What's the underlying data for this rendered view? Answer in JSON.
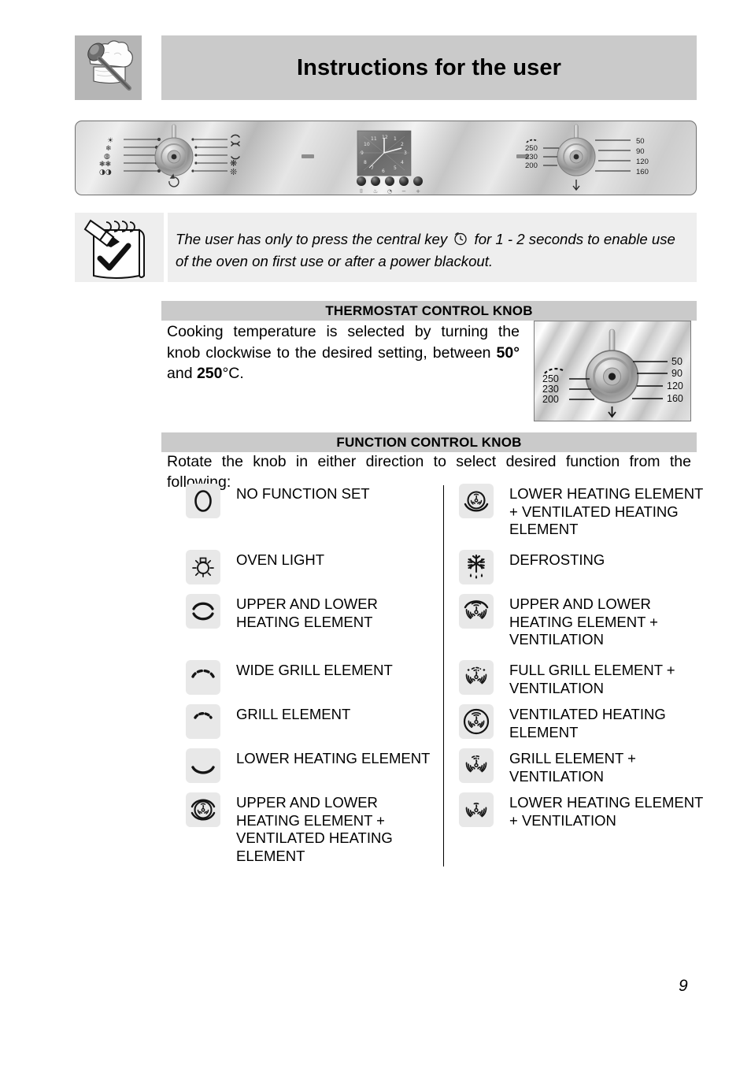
{
  "header": {
    "title": "Instructions for the user",
    "badge_icon": "chef-hat-spoon-icon"
  },
  "control_panel": {
    "function_knob_icon": "function-control-knob",
    "clock_display_icon": "analog-clock-display",
    "thermostat_knob_icon": "thermostat-control-knob",
    "thermostat_left_marks": [
      "250",
      "230",
      "200"
    ],
    "thermostat_right_marks": [
      "50",
      "90",
      "120",
      "160"
    ],
    "clock_buttons": [
      "lock-button",
      "pot-timer-button",
      "clock-button",
      "minus-button",
      "plus-button"
    ]
  },
  "note": {
    "icon": "notepad-check-pencil-icon",
    "text_before": "The user has only to press the central key",
    "inline_icon": "clock-icon",
    "text_after": "for 1 - 2 seconds to enable use of the oven on first use or after a power blackout."
  },
  "thermostat_section": {
    "heading": "THERMOSTAT CONTROL KNOB",
    "body_part1": "Cooking temperature is selected by turning the knob clockwise to the desired setting, between ",
    "body_bold1": "50°",
    "body_mid": " and ",
    "body_bold2": "250",
    "body_part2": "°C.",
    "image_left_marks": [
      "250",
      "230",
      "200"
    ],
    "image_right_marks": [
      "50",
      "90",
      "120",
      "160"
    ]
  },
  "function_section": {
    "heading": "FUNCTION CONTROL KNOB",
    "intro": "Rotate the knob in either direction to select desired function from the following:",
    "left_items": [
      {
        "icon": "no-function-icon",
        "label": "NO FUNCTION SET"
      },
      {
        "icon": "oven-light-icon",
        "label": "OVEN LIGHT"
      },
      {
        "icon": "upper-lower-heating-icon",
        "label": "UPPER AND LOWER HEATING ELEMENT"
      },
      {
        "icon": "wide-grill-icon",
        "label": "WIDE GRILL ELEMENT"
      },
      {
        "icon": "grill-icon",
        "label": "GRILL ELEMENT"
      },
      {
        "icon": "lower-heating-icon",
        "label": "LOWER HEATING ELEMENT"
      },
      {
        "icon": "upper-lower-ventilated-heating-icon",
        "label": "UPPER AND LOWER HEATING ELEMENT + VENTILATED HEATING ELEMENT"
      }
    ],
    "right_items": [
      {
        "icon": "lower-ventilated-heating-icon",
        "label": "LOWER HEATING ELEMENT + VENTILATED HEATING ELEMENT"
      },
      {
        "icon": "defrosting-icon",
        "label": "DEFROSTING"
      },
      {
        "icon": "upper-lower-ventilation-icon",
        "label": "UPPER AND LOWER HEATING ELEMENT + VENTILATION"
      },
      {
        "icon": "full-grill-ventilation-icon",
        "label": "FULL GRILL ELEMENT + VENTILATION"
      },
      {
        "icon": "ventilated-heating-icon",
        "label": "VENTILATED HEATING ELEMENT"
      },
      {
        "icon": "grill-ventilation-icon",
        "label": "GRILL ELEMENT + VENTILATION"
      },
      {
        "icon": "lower-heating-ventilation-icon",
        "label": "LOWER HEATING ELEMENT + VENTILATION"
      }
    ]
  },
  "footer": {
    "page_number": "9"
  }
}
